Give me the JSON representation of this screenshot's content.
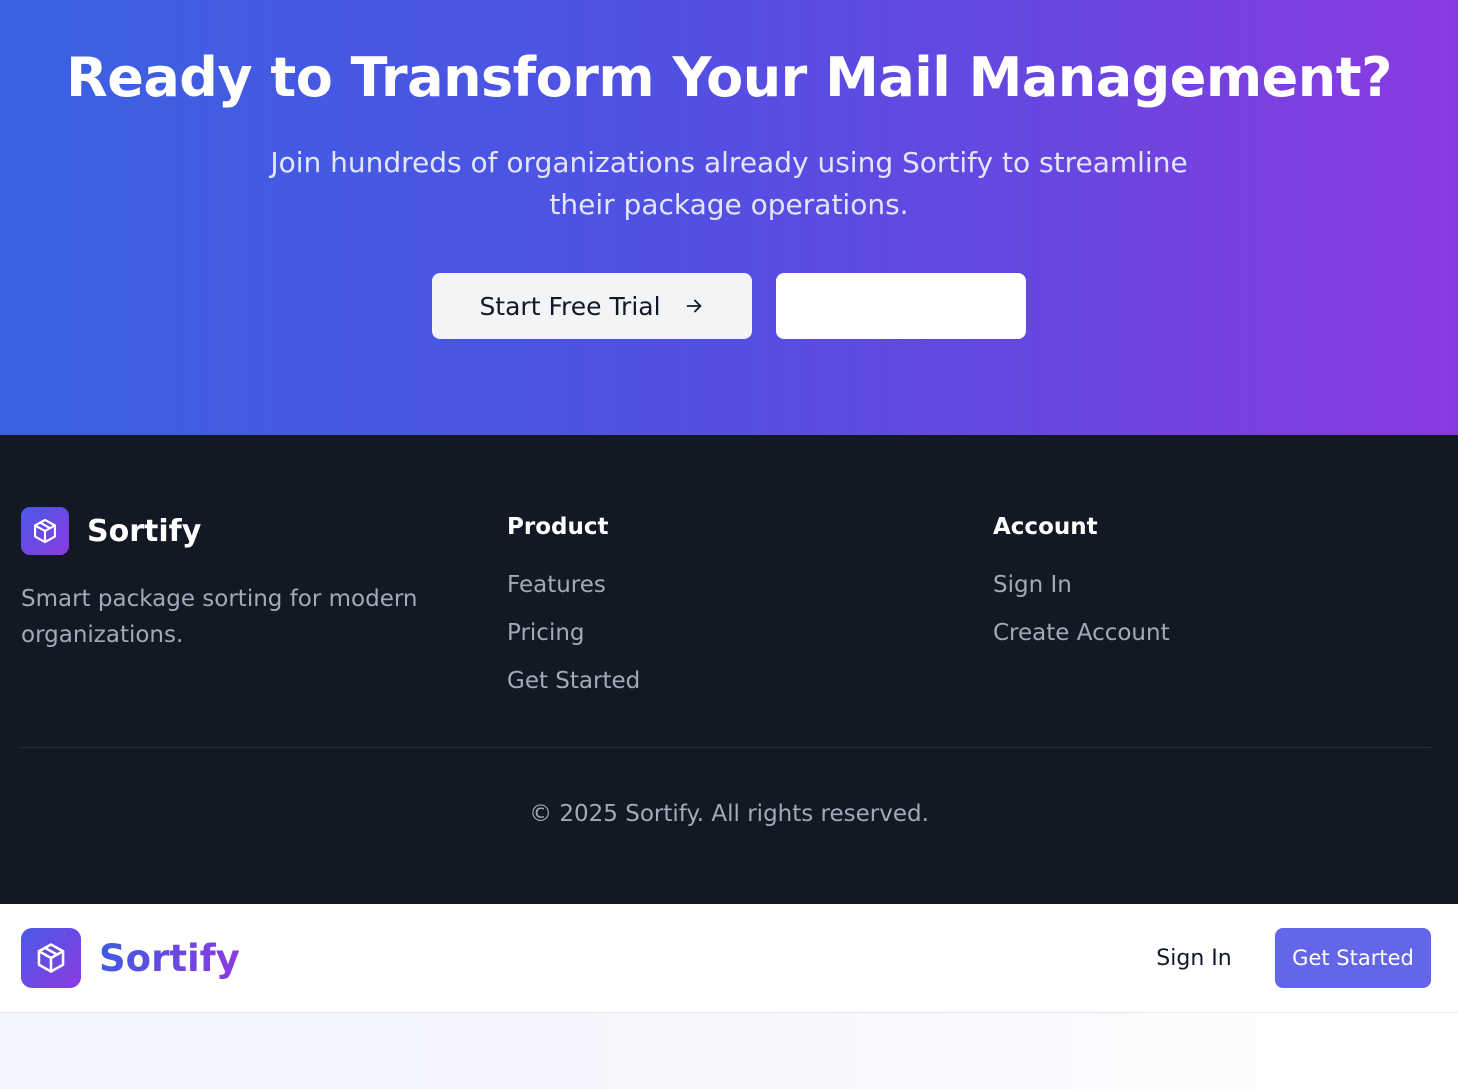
{
  "cta": {
    "title": "Ready to Transform Your Mail Management?",
    "subtitle": "Join hundreds of organizations already using Sortify to streamline their package operations.",
    "primary_button": "Start Free Trial",
    "secondary_button": ""
  },
  "footer": {
    "brand": "Sortify",
    "tagline": "Smart package sorting for modern organizations.",
    "product": {
      "title": "Product",
      "links": [
        "Features",
        "Pricing",
        "Get Started"
      ]
    },
    "account": {
      "title": "Account",
      "links": [
        "Sign In",
        "Create Account"
      ]
    },
    "copyright": "© 2025 Sortify. All rights reserved."
  },
  "navbar": {
    "brand": "Sortify",
    "sign_in": "Sign In",
    "get_started": "Get Started"
  },
  "colors": {
    "gradient_start": "#3a62e2",
    "gradient_end": "#8b3ae1",
    "footer_bg": "#131825",
    "accent": "#6366e9"
  },
  "icons": {
    "logo": "package-box-icon",
    "cta_arrow": "arrow-right-icon"
  }
}
